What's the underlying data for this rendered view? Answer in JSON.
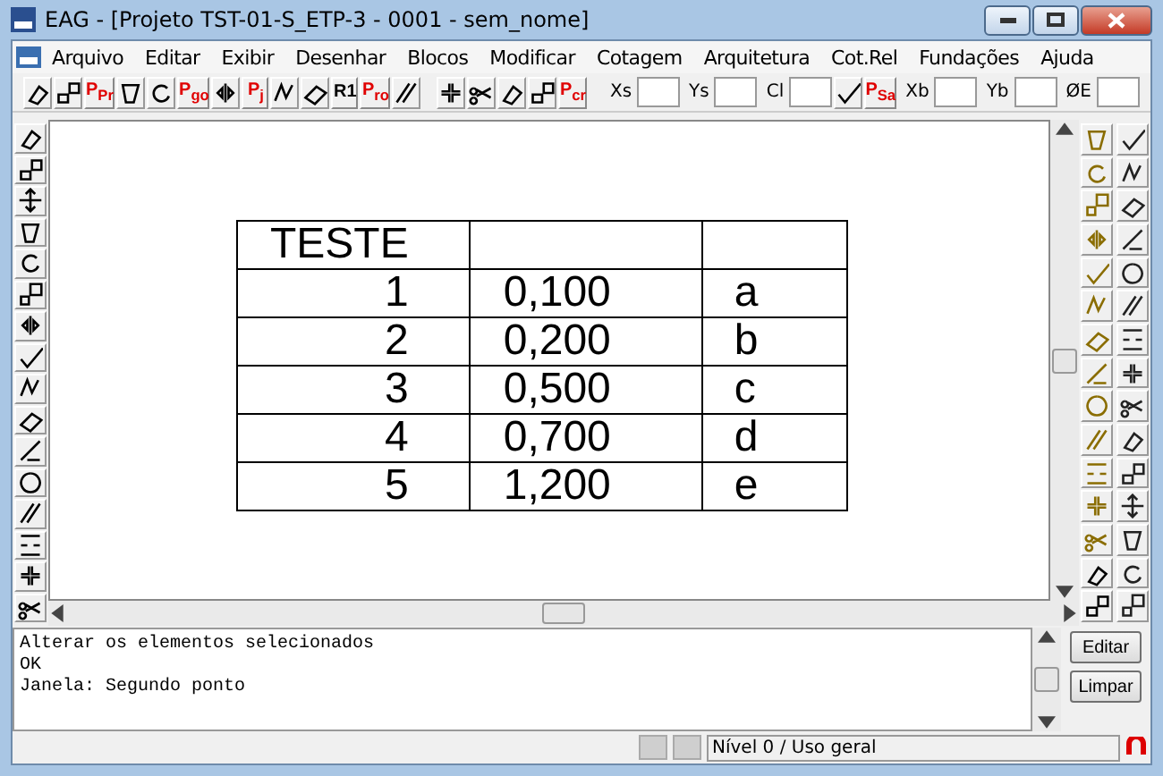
{
  "window": {
    "title": "EAG - [Projeto TST-01-S_ETP-3 - 0001 - sem_nome]"
  },
  "menu": [
    "Arquivo",
    "Editar",
    "Exibir",
    "Desenhar",
    "Blocos",
    "Modificar",
    "Cotagem",
    "Arquitetura",
    "Cot.Rel",
    "Fundações",
    "Ajuda"
  ],
  "toolbar": [
    {
      "kind": "icon"
    },
    {
      "kind": "icon"
    },
    {
      "kind": "text",
      "label": "P$_{Pr}$"
    },
    {
      "kind": "icon"
    },
    {
      "kind": "icon"
    },
    {
      "kind": "text",
      "label": "P$_{go}$"
    },
    {
      "kind": "icon"
    },
    {
      "kind": "text",
      "label": "P$_{j}$"
    },
    {
      "kind": "icon"
    },
    {
      "kind": "icon"
    },
    {
      "kind": "black",
      "label": "R1"
    },
    {
      "kind": "text",
      "label": "P$_{ro}$"
    },
    {
      "kind": "icon"
    },
    {
      "kind": "sep"
    },
    {
      "kind": "icon"
    },
    {
      "kind": "icon"
    },
    {
      "kind": "icon"
    },
    {
      "kind": "icon"
    },
    {
      "kind": "text",
      "label": "P$_{cr}$"
    },
    {
      "kind": "sep"
    },
    {
      "kind": "field",
      "label": "Xs"
    },
    {
      "kind": "field",
      "label": "Ys"
    },
    {
      "kind": "field",
      "label": "Cl"
    },
    {
      "kind": "icon"
    },
    {
      "kind": "text",
      "label": "P$_{Sa}$"
    },
    {
      "kind": "field",
      "label": "Xb"
    },
    {
      "kind": "field",
      "label": "Yb"
    },
    {
      "kind": "field",
      "label": "ØE"
    }
  ],
  "table": {
    "rows": [
      [
        "TESTE",
        "",
        ""
      ],
      [
        "1",
        "0,100",
        "a"
      ],
      [
        "2",
        "0,200",
        "b"
      ],
      [
        "3",
        "0,500",
        "c"
      ],
      [
        "4",
        "0,700",
        "d"
      ],
      [
        "5",
        "1,200",
        "e"
      ]
    ]
  },
  "console": [
    "Alterar os elementos selecionados",
    "OK",
    "Janela: Segundo ponto"
  ],
  "buttons": [
    "Editar",
    "Limpar"
  ],
  "status": "Nível 0 / Uso geral"
}
